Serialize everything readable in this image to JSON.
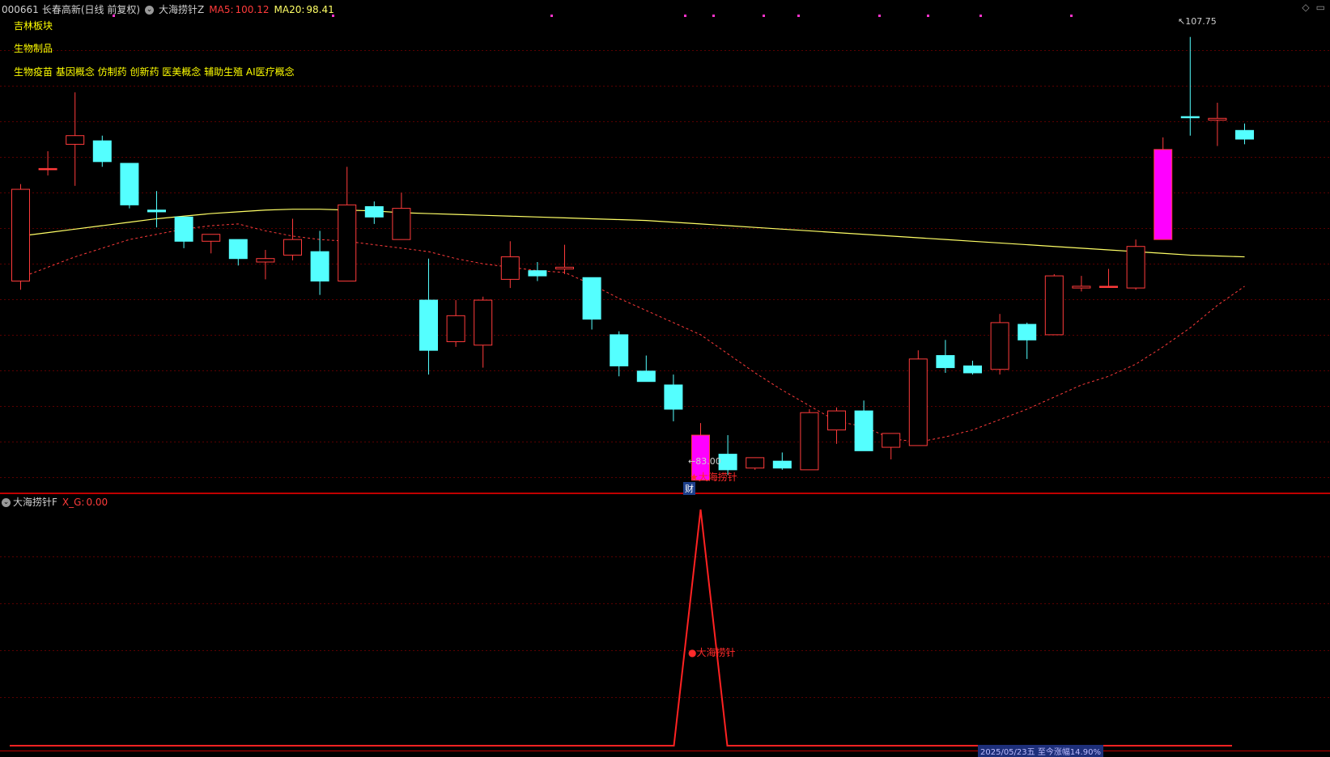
{
  "header": {
    "code": "000661",
    "name": "长春高新",
    "period": "(日线 前复权)",
    "indicator": "大海捞针Z",
    "ma5_label": "MA5:",
    "ma5_value": "100.12",
    "ma20_label": "MA20:",
    "ma20_value": "98.41"
  },
  "tags": {
    "region": "吉林板块",
    "industry": "生物制品",
    "concepts": "生物疫苗 基因概念 仿制药 创新药 医美概念 辅助生殖 AI医疗概念"
  },
  "price_labels": {
    "high": "107.75",
    "low": "83.00"
  },
  "signal": {
    "main_label": "★大海捞针",
    "finance_badge": "财",
    "sub_label": "●大海捞针"
  },
  "sub_panel": {
    "name": "大海捞针F",
    "value_label": "X_G:",
    "value": "0.00"
  },
  "bottom": {
    "badge": "2025/05/23五 至今涨幅14.90%"
  },
  "colors": {
    "up": "#ff3b3b",
    "down": "#54ffff",
    "limit_up": "#ff00ff",
    "ma5": "#ff3b3b",
    "ma20": "#ffff66",
    "grid": "#5a0000"
  },
  "chart_data": {
    "type": "candlestick",
    "y_range": [
      82,
      109
    ],
    "candles": [
      {
        "o": 99.0,
        "h": 99.3,
        "l": 93.2,
        "c": 93.7,
        "kind": "up"
      },
      {
        "o": 100.2,
        "h": 101.2,
        "l": 99.8,
        "c": 100.2,
        "kind": "doji"
      },
      {
        "o": 102.1,
        "h": 104.6,
        "l": 99.2,
        "c": 101.6,
        "kind": "up"
      },
      {
        "o": 101.8,
        "h": 102.1,
        "l": 100.3,
        "c": 100.6,
        "kind": "down"
      },
      {
        "o": 100.5,
        "h": 100.5,
        "l": 97.9,
        "c": 98.1,
        "kind": "down"
      },
      {
        "o": 97.8,
        "h": 98.9,
        "l": 96.8,
        "c": 97.7,
        "kind": "down"
      },
      {
        "o": 97.4,
        "h": 97.4,
        "l": 95.6,
        "c": 96.0,
        "kind": "down"
      },
      {
        "o": 96.0,
        "h": 96.4,
        "l": 95.3,
        "c": 96.4,
        "kind": "up"
      },
      {
        "o": 96.1,
        "h": 96.1,
        "l": 94.6,
        "c": 95.0,
        "kind": "down"
      },
      {
        "o": 94.8,
        "h": 95.5,
        "l": 93.8,
        "c": 95.0,
        "kind": "up"
      },
      {
        "o": 95.2,
        "h": 97.3,
        "l": 94.9,
        "c": 96.1,
        "kind": "up"
      },
      {
        "o": 95.4,
        "h": 96.6,
        "l": 92.9,
        "c": 93.7,
        "kind": "down"
      },
      {
        "o": 93.7,
        "h": 100.3,
        "l": 93.7,
        "c": 98.1,
        "kind": "up"
      },
      {
        "o": 98.0,
        "h": 98.3,
        "l": 97.0,
        "c": 97.4,
        "kind": "down"
      },
      {
        "o": 96.1,
        "h": 98.8,
        "l": 96.1,
        "c": 97.9,
        "kind": "up"
      },
      {
        "o": 92.6,
        "h": 95.0,
        "l": 88.3,
        "c": 89.7,
        "kind": "down"
      },
      {
        "o": 90.2,
        "h": 92.6,
        "l": 89.9,
        "c": 91.7,
        "kind": "up"
      },
      {
        "o": 90.0,
        "h": 92.8,
        "l": 88.7,
        "c": 92.6,
        "kind": "up"
      },
      {
        "o": 93.8,
        "h": 96.0,
        "l": 93.3,
        "c": 95.1,
        "kind": "up"
      },
      {
        "o": 94.3,
        "h": 94.8,
        "l": 93.7,
        "c": 94.0,
        "kind": "down"
      },
      {
        "o": 94.4,
        "h": 95.8,
        "l": 94.1,
        "c": 94.5,
        "kind": "up"
      },
      {
        "o": 93.9,
        "h": 93.9,
        "l": 90.9,
        "c": 91.5,
        "kind": "down"
      },
      {
        "o": 90.6,
        "h": 90.8,
        "l": 88.2,
        "c": 88.8,
        "kind": "down"
      },
      {
        "o": 88.5,
        "h": 89.4,
        "l": 87.9,
        "c": 87.9,
        "kind": "down"
      },
      {
        "o": 87.7,
        "h": 88.3,
        "l": 85.6,
        "c": 86.3,
        "kind": "down"
      },
      {
        "o": 84.8,
        "h": 85.5,
        "l": 83.0,
        "c": 82.2,
        "kind": "limit"
      },
      {
        "o": 83.7,
        "h": 84.8,
        "l": 82.5,
        "c": 82.8,
        "kind": "down"
      },
      {
        "o": 82.9,
        "h": 83.5,
        "l": 82.8,
        "c": 83.5,
        "kind": "up"
      },
      {
        "o": 83.3,
        "h": 83.8,
        "l": 82.8,
        "c": 82.9,
        "kind": "down"
      },
      {
        "o": 82.8,
        "h": 86.3,
        "l": 82.8,
        "c": 86.1,
        "kind": "up"
      },
      {
        "o": 85.1,
        "h": 86.4,
        "l": 84.3,
        "c": 86.2,
        "kind": "up"
      },
      {
        "o": 86.2,
        "h": 86.8,
        "l": 83.9,
        "c": 83.9,
        "kind": "down"
      },
      {
        "o": 84.1,
        "h": 84.9,
        "l": 83.4,
        "c": 84.9,
        "kind": "up"
      },
      {
        "o": 84.2,
        "h": 89.7,
        "l": 84.2,
        "c": 89.2,
        "kind": "up"
      },
      {
        "o": 89.4,
        "h": 90.3,
        "l": 88.4,
        "c": 88.7,
        "kind": "down"
      },
      {
        "o": 88.4,
        "h": 89.1,
        "l": 88.3,
        "c": 88.8,
        "kind": "down"
      },
      {
        "o": 88.6,
        "h": 91.8,
        "l": 88.3,
        "c": 91.3,
        "kind": "up"
      },
      {
        "o": 91.2,
        "h": 91.3,
        "l": 89.2,
        "c": 90.3,
        "kind": "down"
      },
      {
        "o": 90.6,
        "h": 94.1,
        "l": 90.6,
        "c": 94.0,
        "kind": "up"
      },
      {
        "o": 93.3,
        "h": 94.0,
        "l": 93.1,
        "c": 93.4,
        "kind": "up"
      },
      {
        "o": 93.4,
        "h": 94.4,
        "l": 93.4,
        "c": 93.4,
        "kind": "doji"
      },
      {
        "o": 93.3,
        "h": 96.1,
        "l": 93.2,
        "c": 95.7,
        "kind": "up"
      },
      {
        "o": 96.1,
        "h": 102.0,
        "l": 96.1,
        "c": 101.3,
        "kind": "limit"
      },
      {
        "o": 103.2,
        "h": 107.8,
        "l": 102.1,
        "c": 103.2,
        "kind": "doji"
      },
      {
        "o": 103.0,
        "h": 104.0,
        "l": 101.5,
        "c": 103.1,
        "kind": "up"
      },
      {
        "o": 102.4,
        "h": 102.8,
        "l": 101.6,
        "c": 101.9,
        "kind": "down"
      }
    ],
    "ma20": [
      96.3,
      96.5,
      96.7,
      96.9,
      97.1,
      97.3,
      97.45,
      97.6,
      97.7,
      97.8,
      97.85,
      97.85,
      97.8,
      97.75,
      97.65,
      97.6,
      97.55,
      97.5,
      97.45,
      97.4,
      97.35,
      97.3,
      97.25,
      97.2,
      97.1,
      97.0,
      96.9,
      96.8,
      96.7,
      96.6,
      96.5,
      96.4,
      96.3,
      96.2,
      96.1,
      96.0,
      95.9,
      95.8,
      95.7,
      95.6,
      95.5,
      95.4,
      95.3,
      95.2,
      95.15,
      95.1
    ],
    "ma5": [
      93.9,
      94.5,
      95.1,
      95.6,
      96.1,
      96.4,
      96.7,
      96.9,
      97.0,
      96.6,
      96.3,
      96.1,
      96.0,
      95.8,
      95.6,
      95.4,
      95.0,
      94.7,
      94.5,
      94.3,
      94.2,
      93.5,
      92.7,
      92.0,
      91.3,
      90.6,
      89.5,
      88.4,
      87.4,
      86.5,
      85.6,
      85.3,
      84.6,
      84.4,
      84.7,
      85.1,
      85.7,
      86.3,
      87.0,
      87.7,
      88.2,
      88.9,
      89.9,
      91.0,
      92.3,
      93.4
    ],
    "xg_signal_index": 25
  }
}
